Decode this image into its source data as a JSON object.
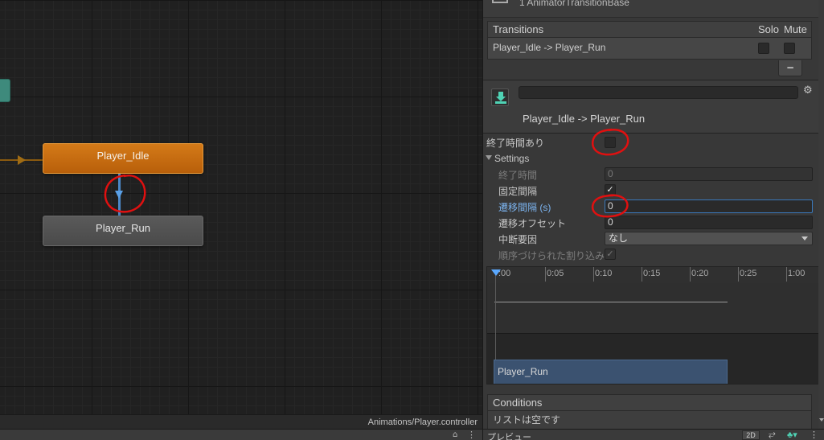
{
  "graph": {
    "states": [
      {
        "name": "Player_Idle"
      },
      {
        "name": "Player_Run"
      }
    ],
    "footer_path": "Animations/Player.controller"
  },
  "inspector": {
    "top_title": "1 AnimatorTransitionBase",
    "transitions": {
      "header": "Transitions",
      "solo_label": "Solo",
      "mute_label": "Mute",
      "rows": [
        {
          "label": "Player_Idle -> Player_Run"
        }
      ],
      "minus_label": "−"
    },
    "transition_name_field": "",
    "transition_title": "Player_Idle -> Player_Run",
    "has_exit_time_label": "終了時間あり",
    "settings": {
      "header": "Settings",
      "exit_time_label": "終了時間",
      "exit_time_value": "0",
      "fixed_duration_label": "固定間隔",
      "fixed_duration_check": "✓",
      "transition_duration_label": "遷移間隔 (s)",
      "transition_duration_value": "0",
      "transition_offset_label": "遷移オフセット",
      "transition_offset_value": "0",
      "interruption_source_label": "中断要因",
      "interruption_source_value": "なし",
      "ordered_interruption_label": "順序づけられた割り込み",
      "ordered_interruption_check": "✓"
    },
    "timeline": {
      "ticks": [
        ":00",
        "0:05",
        "0:10",
        "0:15",
        "0:20",
        "0:25",
        "1:00"
      ],
      "clip_name": "Player_Run"
    },
    "conditions": {
      "header": "Conditions",
      "empty_text": "リストは空です"
    },
    "preview": {
      "label": "プレビュー",
      "mode_2d": "2D"
    }
  },
  "colors": {
    "idle_node": "#c46a10",
    "run_node": "#505050",
    "transition_arrow": "#5aa0e6",
    "annotation_circle": "#e01010",
    "clip_bar": "#3b5270"
  }
}
